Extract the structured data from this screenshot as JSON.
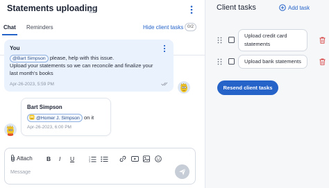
{
  "header": {
    "title": "Statements uploading"
  },
  "tabs": {
    "chat": "Chat",
    "reminders": "Reminders",
    "hide_link": "Hide client tasks",
    "hide_count": "0/2"
  },
  "messages": [
    {
      "author": "You",
      "mention": "@Bart Simpson",
      "line1_rest": "please, help with this issue.",
      "line2": "Upload your statements so we can reconcile and finalize your",
      "line3": "last month's books",
      "time": "Apr-26-2023, 5:59 PM"
    },
    {
      "author": "Bart Simpson",
      "mention": "@Homer J. Simpson",
      "rest": "on it",
      "time": "Apr-26-2023, 6:00 PM"
    }
  ],
  "composer": {
    "attach_label": "Attach",
    "bold": "B",
    "italic": "I",
    "underline": "U",
    "placeholder": "Message"
  },
  "tasks_panel": {
    "title": "Client tasks",
    "add_label": "Add task",
    "tasks": [
      {
        "line1": "Upload credit card",
        "line2": "statements"
      },
      {
        "line1": "Upload bank statements"
      }
    ],
    "resend_label": "Resend client tasks"
  },
  "colors": {
    "accent": "#2563c9",
    "message_bg": "#eaf2fd",
    "delete": "#d64545"
  },
  "icons": [
    "pencil-icon",
    "kebab-icon",
    "read-ticks-icon",
    "paperclip-icon",
    "ordered-list-icon",
    "bullet-list-icon",
    "link-icon",
    "video-icon",
    "image-icon",
    "emoji-icon",
    "send-icon",
    "plus-circle-icon",
    "drag-handle-icon",
    "trash-icon"
  ]
}
